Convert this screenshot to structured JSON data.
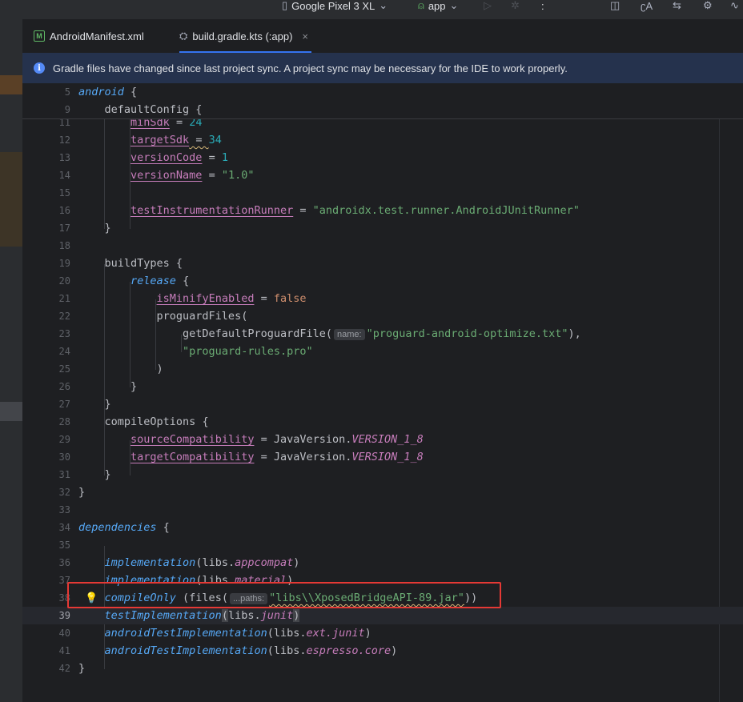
{
  "toolbar": {
    "device": "Google Pixel 3 XL",
    "run_config": "app",
    "more": ":"
  },
  "tabs": [
    {
      "label": "AndroidManifest.xml",
      "icon": "manifest-m-icon"
    },
    {
      "label": "build.gradle.kts (:app)",
      "icon": "gradle-icon",
      "close": "×"
    }
  ],
  "banner": {
    "text": "Gradle files have changed since last project sync. A project sync may be necessary for the IDE to work properly."
  },
  "line_numbers": [
    "5",
    "9",
    "11",
    "12",
    "13",
    "14",
    "15",
    "16",
    "17",
    "18",
    "19",
    "20",
    "21",
    "22",
    "23",
    "24",
    "25",
    "26",
    "27",
    "28",
    "29",
    "30",
    "31",
    "32",
    "33",
    "34",
    "35",
    "36",
    "37",
    "38",
    "39",
    "40",
    "41",
    "42"
  ],
  "code": {
    "l5": [
      "android",
      " {"
    ],
    "l9": [
      "    defaultConfig",
      " {"
    ],
    "l11": [
      "        ",
      "minSdk",
      " = ",
      "24"
    ],
    "l12": [
      "        ",
      "targetSdk",
      " = ",
      "34"
    ],
    "l13": [
      "        ",
      "versionCode",
      " = ",
      "1"
    ],
    "l14": [
      "        ",
      "versionName",
      " = ",
      "\"1.0\""
    ],
    "l16": [
      "        ",
      "testInstrumentationRunner",
      " = ",
      "\"androidx.test.runner.AndroidJUnitRunner\""
    ],
    "l17": "    }",
    "l19": [
      "    buildTypes",
      " {"
    ],
    "l20": [
      "        ",
      "release",
      " {"
    ],
    "l21": [
      "            ",
      "isMinifyEnabled",
      " = ",
      "false"
    ],
    "l22": "            proguardFiles(",
    "l23": [
      "                getDefaultProguardFile(",
      "name:",
      "\"proguard-android-optimize.txt\"",
      "),"
    ],
    "l24": [
      "                ",
      "\"proguard-rules.pro\""
    ],
    "l25": "            )",
    "l26": "        }",
    "l27": "    }",
    "l28": [
      "    compileOptions",
      " {"
    ],
    "l29": [
      "        ",
      "sourceCompatibility",
      " = JavaVersion.",
      "VERSION_1_8"
    ],
    "l30": [
      "        ",
      "targetCompatibility",
      " = JavaVersion.",
      "VERSION_1_8"
    ],
    "l31": "    }",
    "l32": "}",
    "l34": [
      "dependencies",
      " {"
    ],
    "l36": [
      "    ",
      "implementation",
      "(libs.",
      "appcompat",
      ")"
    ],
    "l37": [
      "    ",
      "implementation",
      "(libs.",
      "material",
      ")"
    ],
    "l38": [
      "    ",
      "compileOnly",
      " (files(",
      "...paths:",
      "\"libs\\\\XposedBridgeAPI-89.jar\"",
      "))"
    ],
    "l39": [
      "    ",
      "testImplementation",
      "(",
      "libs.",
      "junit",
      ")"
    ],
    "l40": [
      "    ",
      "androidTestImplementation",
      "(libs.",
      "ext.junit",
      ")"
    ],
    "l41": [
      "    ",
      "androidTestImplementation",
      "(libs.",
      "espresso.core",
      ")"
    ],
    "l42": "}"
  },
  "colors": {
    "background": "#1e1f22",
    "keyword": "#cf8e6d",
    "function": "#56a8f5",
    "string": "#6aab73",
    "number": "#2aacb8",
    "property": "#c77dbb",
    "highlight_box": "#e53935",
    "banner": "#25324d"
  }
}
